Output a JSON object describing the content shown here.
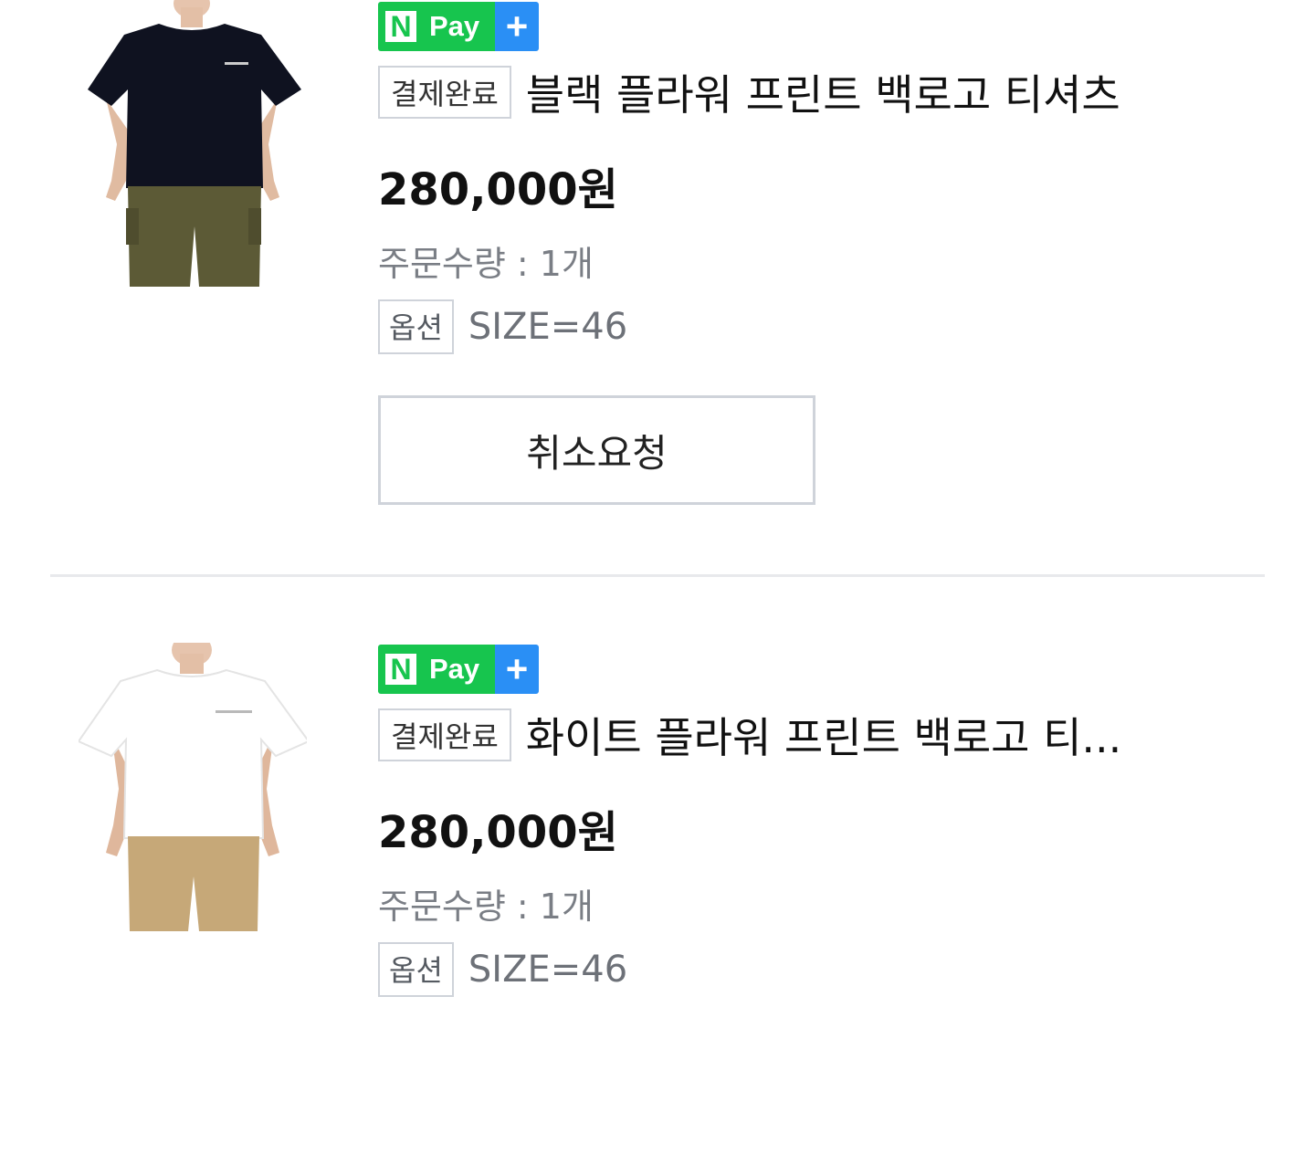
{
  "orders": [
    {
      "npay_label": "Pay",
      "npay_n": "N",
      "npay_plus": "+",
      "status": "결제완료",
      "title": "블랙 플라워 프린트 백로고 티셔츠",
      "price": "280,000원",
      "quantity": "주문수량 : 1개",
      "option_label": "옵션",
      "option_value": "SIZE=46",
      "cancel_label": "취소요청",
      "shirt_color": "#0f1220",
      "pants_color": "#5c5a36"
    },
    {
      "npay_label": "Pay",
      "npay_n": "N",
      "npay_plus": "+",
      "status": "결제완료",
      "title": "화이트 플라워 프린트 백로고 티...",
      "price": "280,000원",
      "quantity": "주문수량 : 1개",
      "option_label": "옵션",
      "option_value": "SIZE=46",
      "shirt_color": "#ffffff",
      "pants_color": "#c6a878"
    }
  ],
  "colors": {
    "npay_green": "#17c54e",
    "npay_blue": "#2a8ff5",
    "border_gray": "#cfd3da",
    "muted_text": "#7a7e85"
  }
}
